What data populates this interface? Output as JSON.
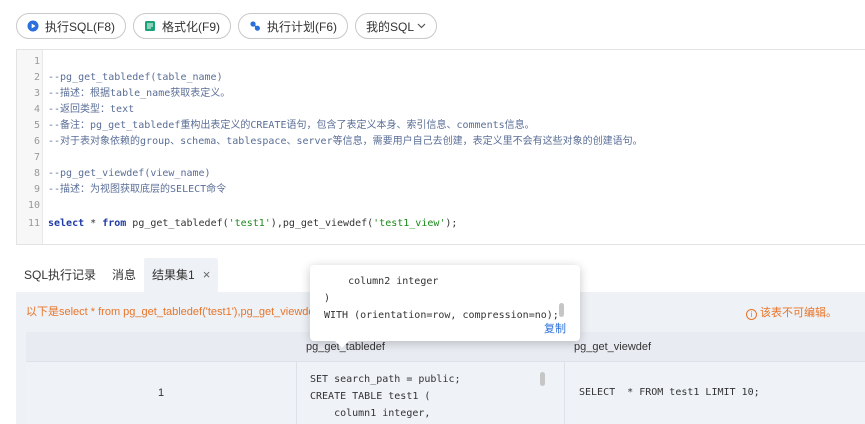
{
  "toolbar": {
    "run_label": "执行SQL(F8)",
    "format_label": "格式化(F9)",
    "plan_label": "执行计划(F6)",
    "mysql_label": "我的SQL"
  },
  "editor": {
    "lines": [
      {
        "n": "1",
        "text": ""
      },
      {
        "n": "2",
        "text": "--pg_get_tabledef(table_name)"
      },
      {
        "n": "3",
        "text": "--描述：根据table_name获取表定义。"
      },
      {
        "n": "4",
        "text": "--返回类型：text"
      },
      {
        "n": "5",
        "text": "--备注：pg_get_tabledef重构出表定义的CREATE语句，包含了表定义本身、索引信息、comments信息。"
      },
      {
        "n": "6",
        "text": "--对于表对象依赖的group、schema、tablespace、server等信息，需要用户自己去创建，表定义里不会有这些对象的创建语句。"
      },
      {
        "n": "7",
        "text": ""
      },
      {
        "n": "8",
        "text": "--pg_get_viewdef(view_name)"
      },
      {
        "n": "9",
        "text": "--描述：为视图获取底层的SELECT命令"
      },
      {
        "n": "10",
        "text": ""
      }
    ],
    "stmt": {
      "n": "11",
      "kw_select": "select",
      "star": " * ",
      "kw_from": "from",
      "part1": " pg_get_tabledef(",
      "str1": "'test1'",
      "part2": "),pg_get_viewdef(",
      "str2": "'test1_view'",
      "part3": ");"
    }
  },
  "tabs": {
    "history": "SQL执行记录",
    "messages": "消息",
    "result": "结果集1",
    "close": "×"
  },
  "results": {
    "warning_left": "以下是select * from pg_get_tabledef('test1'),pg_get_viewdef('test1_view');的执行结果",
    "warning_right": "该表不可编辑。",
    "warning_icon": "i",
    "columns": [
      "",
      "pg_get_tabledef",
      "pg_get_viewdef"
    ],
    "row": {
      "num": "1",
      "tabledef": "SET search_path = public;\nCREATE TABLE test1 (\n    column1 integer,",
      "viewdef": "SELECT  * FROM test1 LIMIT 10;"
    }
  },
  "popup": {
    "line1": "    column2 integer",
    "line2": ")",
    "line3": "WITH (orientation=row, compression=no);",
    "copy_label": "复制"
  },
  "colors": {
    "accent": "#2a6fdb",
    "warning": "#e8752a",
    "keyword": "#1e3aa8",
    "string": "#1a8a1a"
  }
}
